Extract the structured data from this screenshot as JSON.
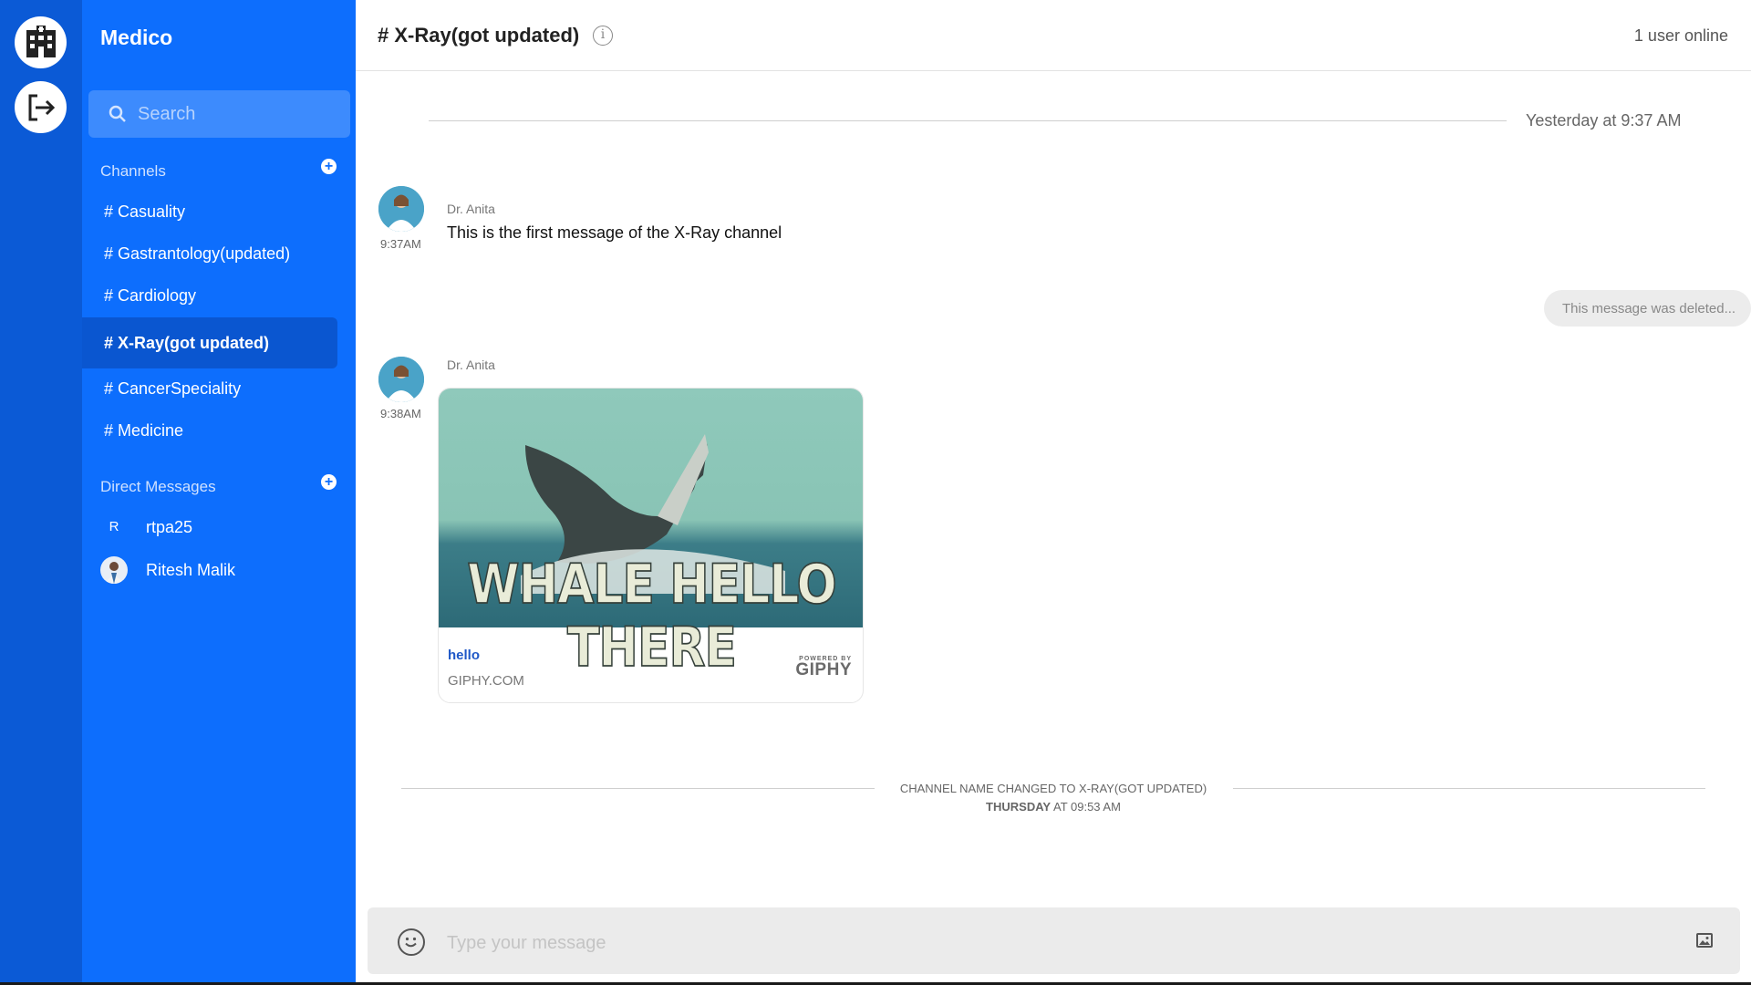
{
  "app": {
    "workspace": "Medico"
  },
  "search": {
    "placeholder": "Search"
  },
  "sidebar": {
    "channels_heading": "Channels",
    "channels": [
      {
        "label": "# Casuality",
        "active": false
      },
      {
        "label": "# Gastrantology(updated)",
        "active": false
      },
      {
        "label": "# Cardiology",
        "active": false
      },
      {
        "label": "# X-Ray(got updated)",
        "active": true
      },
      {
        "label": "# CancerSpeciality",
        "active": false
      },
      {
        "label": "# Medicine",
        "active": false
      }
    ],
    "dm_heading": "Direct Messages",
    "dms": [
      {
        "initial": "R",
        "name": "rtpa25"
      },
      {
        "initial": "",
        "name": "Ritesh Malik"
      }
    ]
  },
  "header": {
    "title": "# X-Ray(got updated)",
    "online": "1 user online"
  },
  "messages": {
    "date_divider": "Yesterday at 9:37 AM",
    "m1": {
      "author": "Dr. Anita",
      "time": "9:37AM",
      "text": "This is the first message of the X-Ray channel"
    },
    "deleted": "This message was deleted...",
    "m2": {
      "author": "Dr. Anita",
      "time": "9:38AM",
      "gif_caption": "WHALE HELLO THERE",
      "link_title": "hello",
      "source": "GIPHY.COM",
      "powered_by": "POWERED BY",
      "brand": "GIPHY"
    },
    "system": {
      "line1": "CHANNEL NAME CHANGED TO X-RAY(GOT UPDATED)",
      "day": "THURSDAY",
      "at": "AT 09:53 AM"
    }
  },
  "composer": {
    "placeholder": "Type your message"
  },
  "colors": {
    "rail": "#0b5ad6",
    "sidebar": "#0d6efd",
    "active_channel": "#0a56d0"
  },
  "icons": [
    "hospital-icon",
    "logout-icon",
    "search-icon",
    "add-channel-icon",
    "add-dm-icon",
    "info-icon",
    "emoji-icon",
    "image-icon"
  ]
}
